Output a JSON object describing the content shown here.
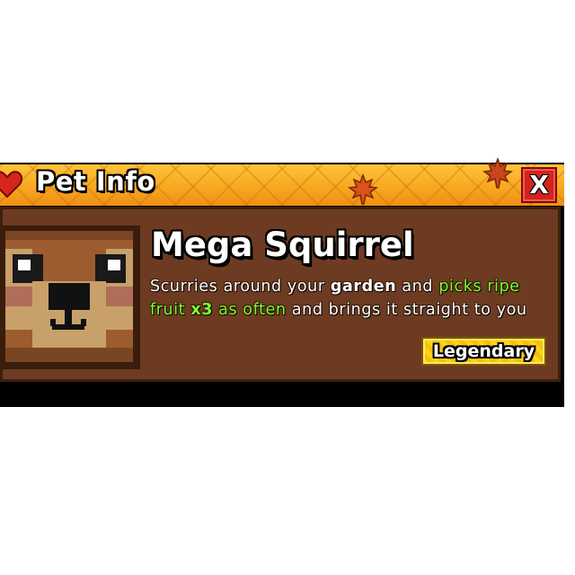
{
  "dialog": {
    "title": "Pet Info",
    "close_label": "X"
  },
  "pet": {
    "name": "Mega Squirrel",
    "description": {
      "t1": "Scurries around your ",
      "t2": "garden",
      "t3": " and ",
      "t4": "picks ripe fruit ",
      "t5": "x3",
      "t6": " as often",
      "t7": " and brings it straight to you"
    },
    "rarity": "Legendary",
    "portrait_icon": "squirrel-face-icon"
  },
  "colors": {
    "header": "#f7a51f",
    "card": "#6d3b21",
    "close_button": "#d3231c",
    "highlight_green": "#7cff2e",
    "rarity_badge": "#ffd21a"
  }
}
